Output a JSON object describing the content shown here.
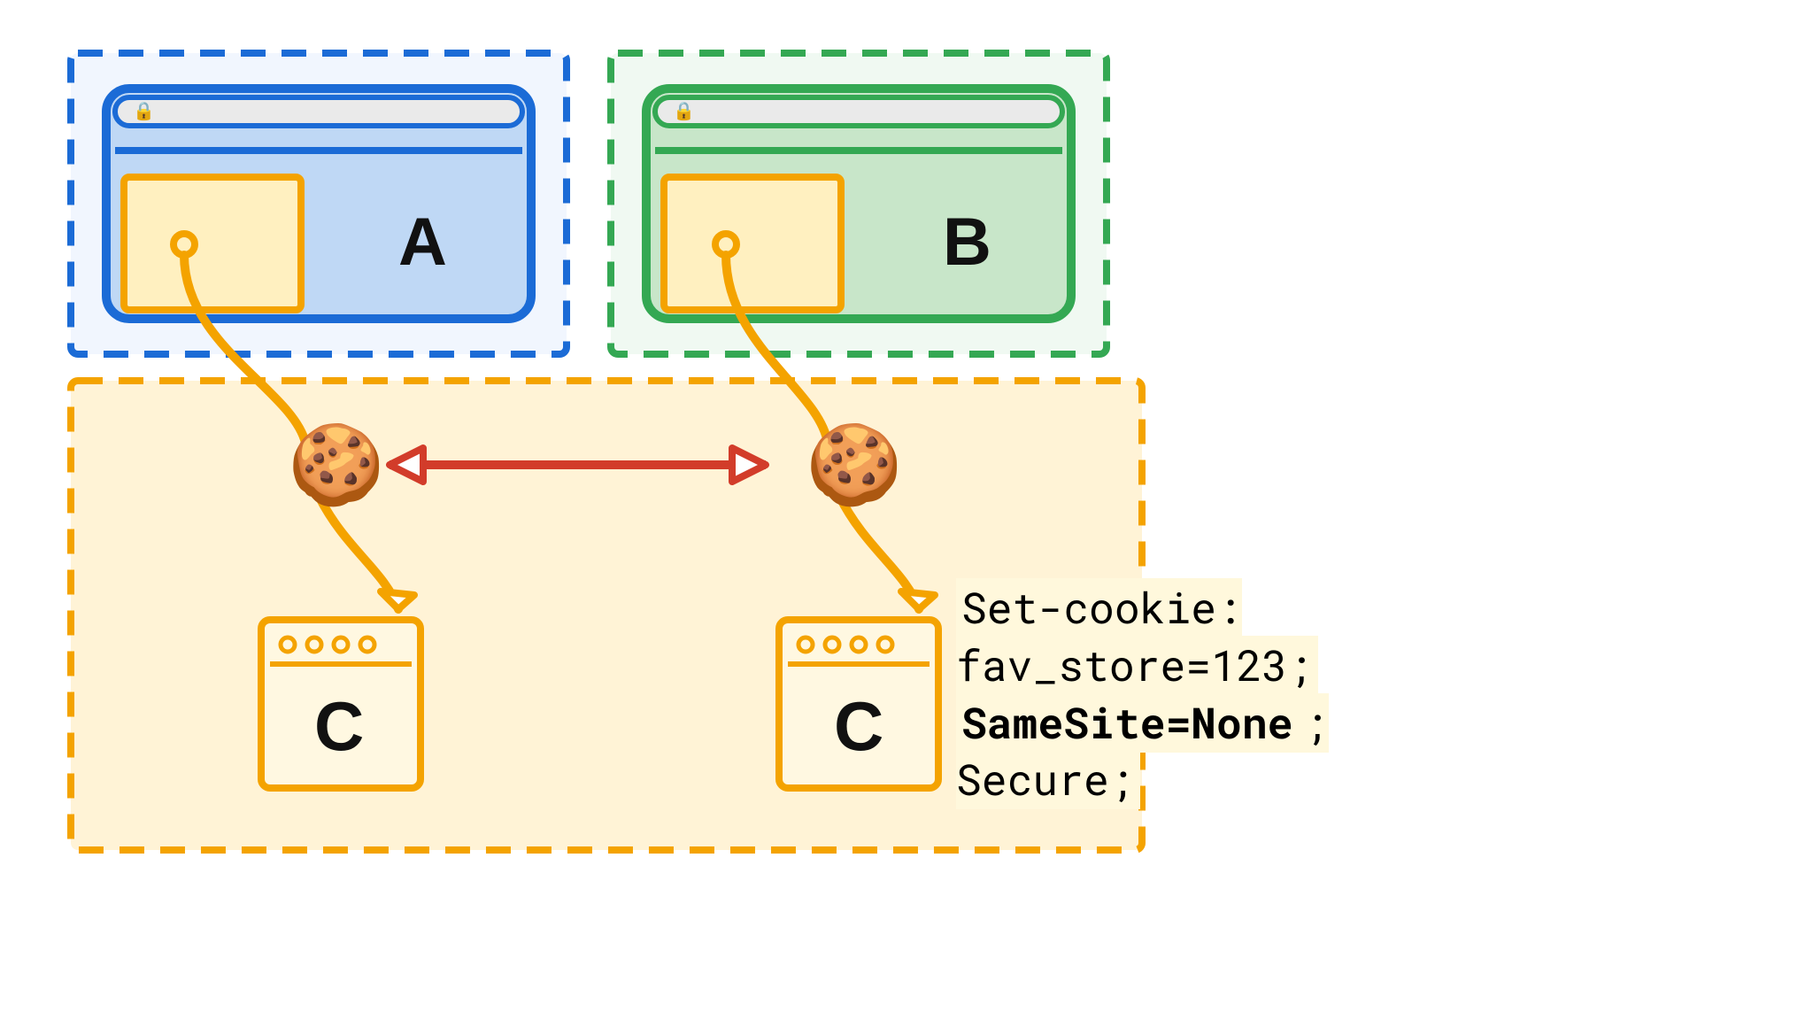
{
  "diagram": {
    "boxA": {
      "label": "A"
    },
    "boxB": {
      "label": "B"
    },
    "siteC_left": {
      "label": "C"
    },
    "siteC_right": {
      "label": "C"
    },
    "cookieHeader": {
      "line1": "Set-cookie: fav_store=123;",
      "line2_bold": "SameSite=None",
      "line2_rest": "; Secure;"
    },
    "colors": {
      "blue": "#1B6BD6",
      "blueFill": "#BFD8F5",
      "green": "#34A853",
      "greenFill": "#C8E6C9",
      "orange": "#F4A300",
      "orangeFill": "#FFF3D6",
      "yellowBox": "#FFF0C0",
      "red": "#D23C2A",
      "gray": "#D7D7D7"
    }
  }
}
